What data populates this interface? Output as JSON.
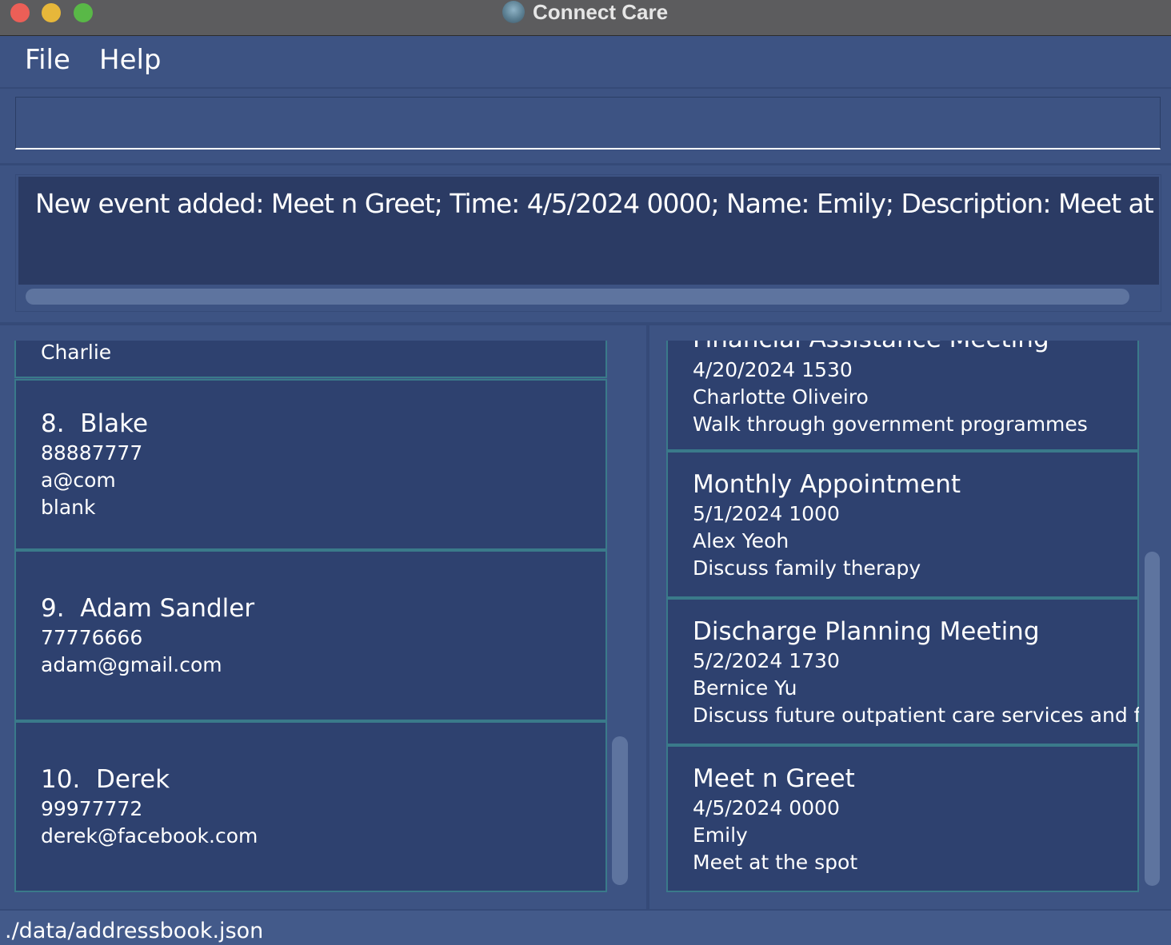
{
  "window": {
    "title": "Connect Care"
  },
  "menu": {
    "items": [
      "File",
      "Help"
    ]
  },
  "command_box": {
    "value": "",
    "placeholder": ""
  },
  "result": {
    "text": "New event added: Meet n Greet; Time: 4/5/2024 0000; Name: Emily; Description: Meet at the spot"
  },
  "persons": [
    {
      "index": "",
      "name": "",
      "lines": [
        "Charlie"
      ]
    },
    {
      "index": "8.",
      "name": "Blake",
      "lines": [
        "88887777",
        "a@com",
        "blank"
      ]
    },
    {
      "index": "9.",
      "name": "Adam Sandler",
      "lines": [
        "77776666",
        "adam@gmail.com"
      ]
    },
    {
      "index": "10.",
      "name": "Derek",
      "lines": [
        "99977772",
        "derek@facebook.com"
      ]
    }
  ],
  "events": [
    {
      "title": "Financial Assistance Meeting",
      "time": "4/20/2024 1530",
      "name": "Charlotte Oliveiro",
      "description": "Walk through government programmes"
    },
    {
      "title": "Monthly Appointment",
      "time": "5/1/2024 1000",
      "name": "Alex Yeoh",
      "description": "Discuss family therapy"
    },
    {
      "title": "Discharge Planning Meeting",
      "time": "5/2/2024 1730",
      "name": "Bernice Yu",
      "description": "Discuss future outpatient care services and fin..."
    },
    {
      "title": "Meet n Greet",
      "time": "4/5/2024 0000",
      "name": "Emily",
      "description": "Meet at the spot"
    }
  ],
  "status": {
    "path": "./data/addressbook.json"
  },
  "colors": {
    "background": "#3d5383",
    "card": "#2e416f",
    "card_border": "#3a7a8a",
    "result_bg": "#2b3b64"
  }
}
